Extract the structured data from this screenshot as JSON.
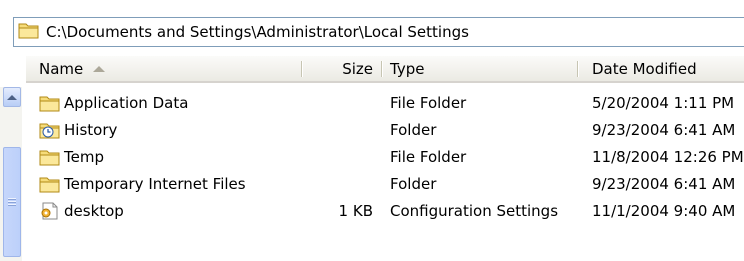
{
  "address_bar": {
    "path": "C:\\Documents and Settings\\Administrator\\Local Settings",
    "icon": "folder-icon"
  },
  "columns": {
    "name": "Name",
    "size": "Size",
    "type": "Type",
    "date": "Date Modified"
  },
  "files": [
    {
      "name": "Application Data",
      "size": "",
      "type": "File Folder",
      "date": "5/20/2004 1:11 PM",
      "icon": "folder-icon"
    },
    {
      "name": "History",
      "size": "",
      "type": "Folder",
      "date": "9/23/2004 6:41 AM",
      "icon": "history-folder-icon"
    },
    {
      "name": "Temp",
      "size": "",
      "type": "File Folder",
      "date": "11/8/2004 12:26 PM",
      "icon": "folder-icon"
    },
    {
      "name": "Temporary Internet Files",
      "size": "",
      "type": "Folder",
      "date": "9/23/2004 6:41 AM",
      "icon": "folder-icon"
    },
    {
      "name": "desktop",
      "size": "1 KB",
      "type": "Configuration Settings",
      "date": "11/1/2004 9:40 AM",
      "icon": "settings-file-icon"
    }
  ],
  "colors": {
    "folder": "#f3d56b",
    "folder_dark": "#c9a227",
    "header_border": "#d6d3ce"
  }
}
